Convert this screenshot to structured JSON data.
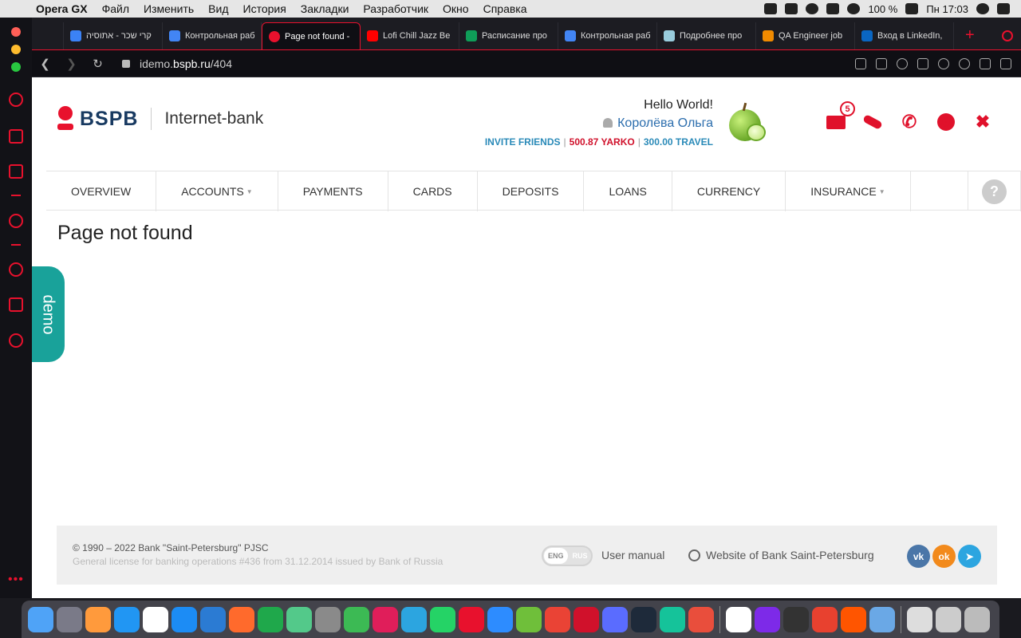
{
  "menubar": {
    "app_name": "Opera GX",
    "items": [
      "Файл",
      "Изменить",
      "Вид",
      "История",
      "Закладки",
      "Разработчик",
      "Окно",
      "Справка"
    ],
    "battery": "100 %",
    "clock": "Пн 17:03"
  },
  "tabs": [
    {
      "title": "קרי שכר - אתוסיה",
      "color": "#3b82f6"
    },
    {
      "title": "Контрольная раб",
      "color": "#4285f4"
    },
    {
      "title": "Page not found -",
      "color": "#e8112d",
      "active": true
    },
    {
      "title": "Lofi Chill Jazz Be",
      "color": "#ff0000"
    },
    {
      "title": "Расписание про",
      "color": "#0f9d58"
    },
    {
      "title": "Контрольная раб",
      "color": "#4285f4"
    },
    {
      "title": "Подробнее про",
      "color": "#9cd"
    },
    {
      "title": "QA Engineer job",
      "color": "#f08a00"
    },
    {
      "title": "Вход в LinkedIn,",
      "color": "#0a66c2"
    }
  ],
  "address": {
    "url_prefix": "idemo.",
    "url_domain": "bspb.ru",
    "url_path": "/404"
  },
  "header": {
    "logo_text": "BSPB",
    "logo_sub": "Internet-bank",
    "greeting": "Hello World!",
    "user_name": "Королёва Ольга",
    "invite": "INVITE FRIENDS",
    "yarko": "500.87 YARKO",
    "travel": "300.00 TRAVEL",
    "mail_badge": "5",
    "separator": "|"
  },
  "nav": {
    "items": [
      {
        "label": "OVERVIEW",
        "dropdown": false
      },
      {
        "label": "ACCOUNTS",
        "dropdown": true
      },
      {
        "label": "PAYMENTS",
        "dropdown": false
      },
      {
        "label": "CARDS",
        "dropdown": false
      },
      {
        "label": "DEPOSITS",
        "dropdown": false
      },
      {
        "label": "LOANS",
        "dropdown": false
      },
      {
        "label": "CURRENCY",
        "dropdown": false
      },
      {
        "label": "INSURANCE",
        "dropdown": true
      }
    ],
    "help": "?"
  },
  "main": {
    "title": "Page not found"
  },
  "demo_tab": "demo",
  "footer": {
    "copyright": "© 1990 – 2022 Bank \"Saint-Petersburg\" PJSC",
    "license": "General license for banking operations #436 from 31.12.2014 issued by Bank of Russia",
    "lang_eng": "ENG",
    "lang_rus": "RUS",
    "user_manual": "User manual",
    "website": "Website of Bank Saint-Petersburg",
    "social_vk": "vk",
    "social_ok": "ok"
  },
  "colors": {
    "brand_red": "#e0112b",
    "brand_navy": "#183a61",
    "demo_teal": "#19a29a",
    "opera_accent": "#e8112d"
  },
  "dock_apps": [
    "#4fa3f7",
    "#7a7a88",
    "#ff9a3c",
    "#2196f3",
    "#ffffff",
    "#1c8cf5",
    "#2b7bd3",
    "#ff6a2c",
    "#1fa84b",
    "#53c98a",
    "#8a8a8a",
    "#3cba54",
    "#e01e5a",
    "#2ca5e0",
    "#25d366",
    "#e8112d",
    "#2d8cff",
    "#6fbf3a",
    "#ea4335",
    "#d0112b",
    "#5a6cff",
    "#1e2a3a",
    "#15c39a",
    "#e94e3c",
    "#ffffff",
    "#7d2ae8",
    "#333333",
    "#e8412f",
    "#ff5500",
    "#6aa8e6",
    "#dddddd",
    "#cccccc",
    "#bbbbbb"
  ]
}
